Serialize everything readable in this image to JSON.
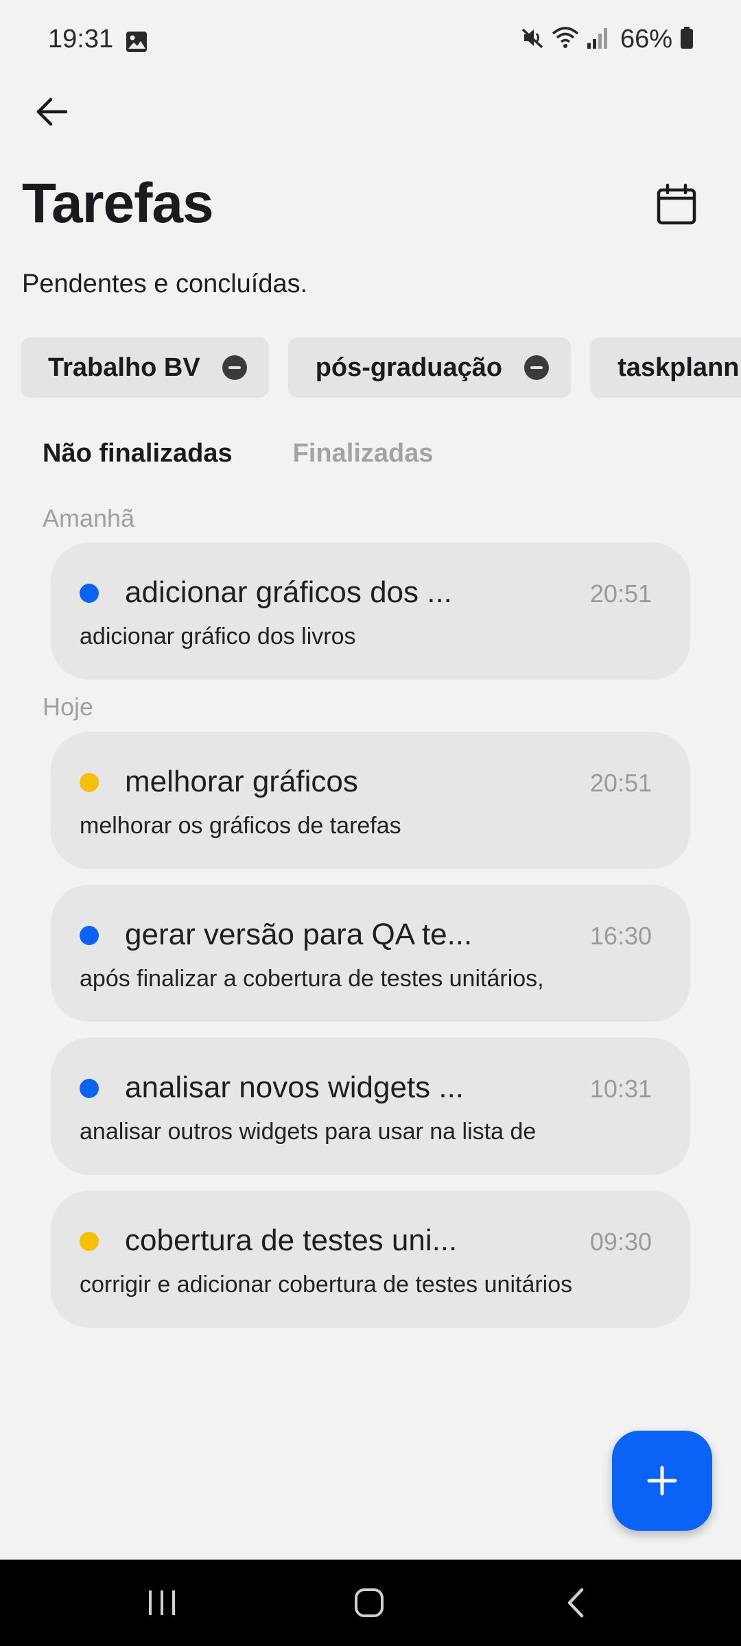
{
  "status_bar": {
    "time": "19:31",
    "battery": "66%",
    "icons": [
      "gallery-icon",
      "mute-icon",
      "wifi-icon",
      "signal-icon",
      "battery-icon"
    ]
  },
  "header": {
    "title": "Tarefas",
    "subtitle": "Pendentes e concluídas.",
    "icons": [
      "back-arrow-icon",
      "calendar-icon"
    ]
  },
  "filters": [
    {
      "label": "Trabalho BV"
    },
    {
      "label": "pós-graduação"
    },
    {
      "label": "taskplann"
    }
  ],
  "tabs": [
    {
      "label": "Não finalizadas",
      "active": true
    },
    {
      "label": "Finalizadas",
      "active": false
    }
  ],
  "sections": [
    {
      "label": "Amanhã",
      "tasks": [
        {
          "title": "adicionar gráficos dos ...",
          "time": "20:51",
          "description": "adicionar gráfico dos livros",
          "dot_color": "#0b63f6"
        }
      ]
    },
    {
      "label": "Hoje",
      "tasks": [
        {
          "title": "melhorar gráficos",
          "time": "20:51",
          "description": "melhorar os gráficos de tarefas",
          "dot_color": "#f5c000"
        },
        {
          "title": "gerar versão para QA te...",
          "time": "16:30",
          "description": "após finalizar a cobertura de testes unitários,",
          "dot_color": "#0b63f6"
        },
        {
          "title": "analisar novos widgets ...",
          "time": "10:31",
          "description": "analisar outros widgets para usar na lista de",
          "dot_color": "#0b63f6"
        },
        {
          "title": "cobertura de testes uni...",
          "time": "09:30",
          "description": "corrigir e adicionar cobertura de testes unitários",
          "dot_color": "#f5c000"
        }
      ]
    }
  ],
  "fab": {
    "icon": "plus-icon",
    "color": "#0b63f6"
  },
  "nav_bar": {
    "icons": [
      "recent-apps-icon",
      "home-icon",
      "back-icon"
    ]
  }
}
